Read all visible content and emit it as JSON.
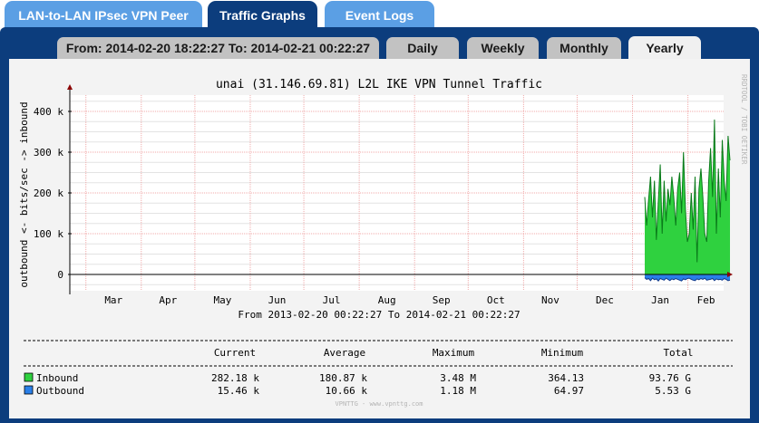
{
  "main_tabs": [
    {
      "label": "LAN-to-LAN IPsec VPN Peer",
      "active": false
    },
    {
      "label": "Traffic Graphs",
      "active": true
    },
    {
      "label": "Event Logs",
      "active": false
    }
  ],
  "range_tab": {
    "label": "From: 2014-02-20 18:22:27 To: 2014-02-21 00:22:27"
  },
  "period_tabs": [
    {
      "label": "Daily",
      "active": false
    },
    {
      "label": "Weekly",
      "active": false
    },
    {
      "label": "Monthly",
      "active": false
    },
    {
      "label": "Yearly",
      "active": true
    }
  ],
  "chart_data": {
    "type": "area",
    "title": "unai (31.146.69.81) L2L IKE VPN Tunnel Traffic",
    "ylabel": "outbound <- bits/sec -> inbound",
    "watermark": "RRDTOOL / TOBI OETIKER",
    "ytick_labels": [
      "400 k",
      "300 k",
      "200 k",
      "100 k",
      "0"
    ],
    "ytick_values": [
      400000,
      300000,
      200000,
      100000,
      0
    ],
    "ylim": [
      -40000,
      440000
    ],
    "xtick_labels": [
      "Mar",
      "Apr",
      "May",
      "Jun",
      "Jul",
      "Aug",
      "Sep",
      "Oct",
      "Nov",
      "Dec",
      "Jan",
      "Feb"
    ],
    "x_range_label": "From 2013-02-20 00:22:27  To 2014-02-21 00:22:27",
    "grid": true,
    "series": [
      {
        "name": "Inbound",
        "color": "#2fd13f",
        "line_color": "#0a7a1a",
        "values": [
          190000,
          120000,
          185000,
          240000,
          140000,
          230000,
          85000,
          180000,
          270000,
          100000,
          230000,
          130000,
          210000,
          170000,
          240000,
          190000,
          120000,
          210000,
          250000,
          150000,
          300000,
          160000,
          80000,
          100000,
          200000,
          110000,
          240000,
          30000,
          210000,
          260000,
          190000,
          100000,
          80000,
          230000,
          310000,
          190000,
          380000,
          100000,
          260000,
          140000,
          330000,
          230000,
          180000,
          340000,
          280000
        ]
      },
      {
        "name": "Outbound",
        "color": "#2a7fe8",
        "line_color": "#123a8a",
        "values": [
          -8000,
          -12000,
          -10000,
          -15000,
          -9000,
          -13000,
          -11000,
          -16000,
          -10000,
          -12000,
          -14000,
          -9000,
          -12000,
          -15000,
          -11000,
          -13000,
          -10000,
          -12000,
          -14000,
          -16000,
          -11000,
          -13000,
          -10000,
          -9000,
          -12000,
          -14000,
          -15000,
          -11000,
          -13000,
          -10000,
          -12000,
          -9000,
          -14000,
          -13000,
          -12000,
          -10000,
          -15000,
          -11000,
          -13000,
          -12000,
          -14000,
          -10000,
          -12000,
          -15000,
          -14000
        ]
      }
    ],
    "stats": {
      "headers": [
        "Current",
        "Average",
        "Maximum",
        "Minimum",
        "Total"
      ],
      "rows": [
        {
          "name": "Inbound",
          "color": "#2fd13f",
          "values": [
            "282.18 k",
            "180.87 k",
            "3.48 M",
            "364.13",
            "93.76 G"
          ]
        },
        {
          "name": "Outbound",
          "color": "#2a7fe8",
          "values": [
            "15.46 k",
            "10.66 k",
            "1.18 M",
            "64.97",
            "5.53 G"
          ]
        }
      ]
    },
    "footer": "VPNTTG - www.vpnttg.com"
  }
}
